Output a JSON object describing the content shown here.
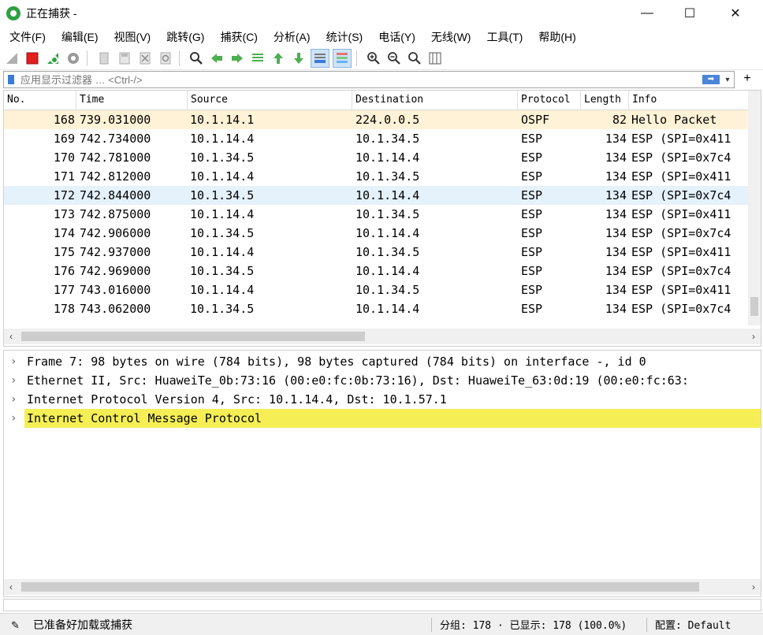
{
  "window": {
    "title": "正在捕获 -",
    "minimize_glyph": "—",
    "maximize_glyph": "☐",
    "close_glyph": "✕"
  },
  "menu": [
    "文件(F)",
    "编辑(E)",
    "视图(V)",
    "跳转(G)",
    "捕获(C)",
    "分析(A)",
    "统计(S)",
    "电话(Y)",
    "无线(W)",
    "工具(T)",
    "帮助(H)"
  ],
  "toolbar": {
    "icons": [
      "start-capture-icon",
      "stop-capture-icon",
      "restart-capture-icon",
      "capture-options-icon",
      "open-file-icon",
      "save-file-icon",
      "close-file-icon",
      "reload-file-icon",
      "find-packet-icon",
      "go-back-icon",
      "go-forward-icon",
      "go-to-packet-icon",
      "go-first-icon",
      "go-last-icon",
      "autoscroll-icon",
      "colorize-icon",
      "zoom-in-icon",
      "zoom-out-icon",
      "zoom-normal-icon",
      "resize-columns-icon"
    ]
  },
  "filter": {
    "placeholder": "应用显示过滤器 … <Ctrl-/>",
    "apply_glyph": "➡",
    "dropdown_glyph": "▾",
    "add_glyph": "+"
  },
  "packet_list": {
    "columns": [
      "No.",
      "Time",
      "Source",
      "Destination",
      "Protocol",
      "Length",
      "Info"
    ],
    "rows": [
      {
        "no": "168",
        "time": "739.031000",
        "src": "10.1.14.1",
        "dst": "224.0.0.5",
        "proto": "OSPF",
        "len": "82",
        "info": "Hello Packet"
      },
      {
        "no": "169",
        "time": "742.734000",
        "src": "10.1.14.4",
        "dst": "10.1.34.5",
        "proto": "ESP",
        "len": "134",
        "info": "ESP (SPI=0x411"
      },
      {
        "no": "170",
        "time": "742.781000",
        "src": "10.1.34.5",
        "dst": "10.1.14.4",
        "proto": "ESP",
        "len": "134",
        "info": "ESP (SPI=0x7c4"
      },
      {
        "no": "171",
        "time": "742.812000",
        "src": "10.1.14.4",
        "dst": "10.1.34.5",
        "proto": "ESP",
        "len": "134",
        "info": "ESP (SPI=0x411"
      },
      {
        "no": "172",
        "time": "742.844000",
        "src": "10.1.34.5",
        "dst": "10.1.14.4",
        "proto": "ESP",
        "len": "134",
        "info": "ESP (SPI=0x7c4"
      },
      {
        "no": "173",
        "time": "742.875000",
        "src": "10.1.14.4",
        "dst": "10.1.34.5",
        "proto": "ESP",
        "len": "134",
        "info": "ESP (SPI=0x411"
      },
      {
        "no": "174",
        "time": "742.906000",
        "src": "10.1.34.5",
        "dst": "10.1.14.4",
        "proto": "ESP",
        "len": "134",
        "info": "ESP (SPI=0x7c4"
      },
      {
        "no": "175",
        "time": "742.937000",
        "src": "10.1.14.4",
        "dst": "10.1.34.5",
        "proto": "ESP",
        "len": "134",
        "info": "ESP (SPI=0x411"
      },
      {
        "no": "176",
        "time": "742.969000",
        "src": "10.1.34.5",
        "dst": "10.1.14.4",
        "proto": "ESP",
        "len": "134",
        "info": "ESP (SPI=0x7c4"
      },
      {
        "no": "177",
        "time": "743.016000",
        "src": "10.1.14.4",
        "dst": "10.1.34.5",
        "proto": "ESP",
        "len": "134",
        "info": "ESP (SPI=0x411"
      },
      {
        "no": "178",
        "time": "743.062000",
        "src": "10.1.34.5",
        "dst": "10.1.14.4",
        "proto": "ESP",
        "len": "134",
        "info": "ESP (SPI=0x7c4"
      }
    ]
  },
  "packet_details": {
    "items": [
      "Frame 7: 98 bytes on wire (784 bits), 98 bytes captured (784 bits) on interface -, id 0",
      "Ethernet II, Src: HuaweiTe_0b:73:16 (00:e0:fc:0b:73:16), Dst: HuaweiTe_63:0d:19 (00:e0:fc:63:",
      "Internet Protocol Version 4, Src: 10.1.14.4, Dst: 10.1.57.1",
      "Internet Control Message Protocol"
    ],
    "expand_glyph": "›"
  },
  "scroll": {
    "left": "‹",
    "right": "›"
  },
  "status": {
    "ready": "已准备好加载或捕获",
    "stats": "分组: 178 · 已显示: 178 (100.0%)",
    "profile": "配置: Default"
  },
  "colors": {
    "ospf_row": "#fff2d6",
    "selected_row": "#e5f1fb",
    "highlight_detail": "#f5ef55",
    "stop_red": "#e11d1d",
    "fin_green": "#2ea043"
  }
}
